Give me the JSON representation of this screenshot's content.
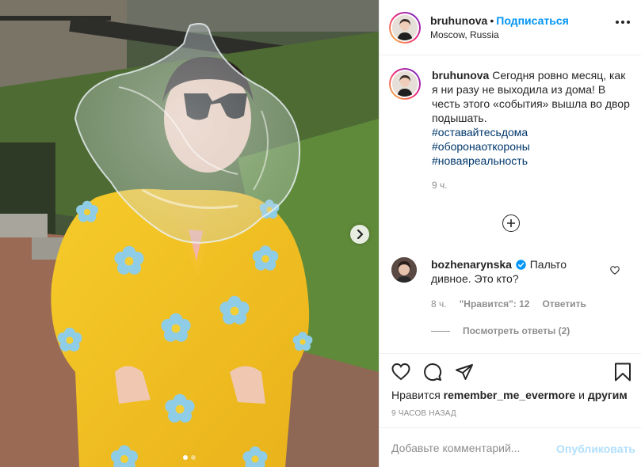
{
  "post": {
    "author": "bruhunova",
    "separator": "•",
    "follow_label": "Подписаться",
    "location": "Moscow, Russia",
    "caption_author": "bruhunova",
    "caption_text": "Сегодня ровно месяц, как я ни разу не выходила из дома! В честь этого «события» вышла во двор подышать.",
    "hashtags": [
      "#оставайтесьдома",
      "#оборонаоткороны",
      "#новаяреальность"
    ],
    "caption_time": "9 ч.",
    "likes_prefix": "Нравится",
    "likes_user": "remember_me_evermore",
    "likes_and": "и",
    "likes_others": "другим",
    "post_time": "9 ЧАСОВ НАЗАД",
    "carousel": {
      "count": 2,
      "active": 0
    }
  },
  "comment": {
    "author": "bozhenarynska",
    "text": "Пальто дивное. Это кто?",
    "time": "8 ч.",
    "likes_label": "\"Нравится\": 12",
    "reply_label": "Ответить",
    "view_replies": "Посмотреть ответы (2)"
  },
  "input": {
    "placeholder": "Добавьте комментарий...",
    "publish_label": "Опубликовать"
  },
  "icons": {
    "more": "more-options-icon",
    "add": "add-circle-icon",
    "heart": "heart-icon",
    "comment": "comment-icon",
    "share": "share-icon",
    "save": "bookmark-icon",
    "next": "chevron-right-icon",
    "verified": "verified-badge-icon"
  },
  "colors": {
    "accent": "#0095f6",
    "publish_disabled": "#b2dffc",
    "hashtag": "#00376b",
    "muted": "#8e8e8e",
    "verified": "#0095f6"
  }
}
